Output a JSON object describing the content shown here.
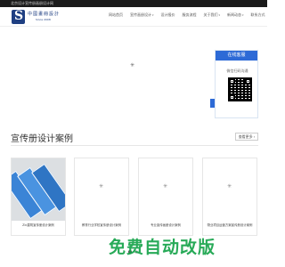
{
  "topbar": {
    "text": "北京设计宣传册画册设计网"
  },
  "logo": {
    "title": "中國畫冊設計",
    "subtitle": "Since 2008"
  },
  "nav": [
    {
      "label": "网站首页",
      "dropdown": false
    },
    {
      "label": "宣传画册设计",
      "dropdown": true
    },
    {
      "label": "设计报价",
      "dropdown": false
    },
    {
      "label": "服务流程",
      "dropdown": false
    },
    {
      "label": "关于我们",
      "dropdown": true
    },
    {
      "label": "新闻动态",
      "dropdown": true
    },
    {
      "label": "联系方式",
      "dropdown": false
    }
  ],
  "float_panel": {
    "heading": "在线客服",
    "label": "微信扫码沟通"
  },
  "section": {
    "title": "宣传册设计案例",
    "more_label": "查看更多"
  },
  "cards": [
    {
      "caption": "Zlc建筑宣传册设计案例",
      "has_image": true
    },
    {
      "caption": "教育行业学校宣传册设计案例",
      "has_image": false
    },
    {
      "caption": "专业宣传画册设计案例",
      "has_image": false
    },
    {
      "caption": "物业项目运营方案宣传册设计案例",
      "has_image": false
    }
  ],
  "watermark": "免费自动改版",
  "icons": {
    "loader": "spinner-icon",
    "caret": "chevron-down-icon"
  },
  "colors": {
    "brand": "#1f3f82",
    "accent": "#2d6ad6",
    "watermark": "#16a34a"
  }
}
